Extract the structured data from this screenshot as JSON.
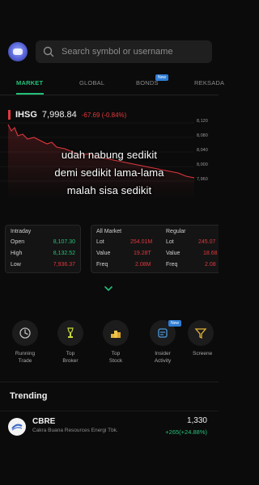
{
  "header": {
    "search_placeholder": "Search symbol or username"
  },
  "tabs": [
    {
      "label": "MARKET",
      "active": true
    },
    {
      "label": "GLOBAL",
      "active": false
    },
    {
      "label": "BONDS",
      "active": false,
      "badge": "New"
    },
    {
      "label": "REKSADA",
      "active": false
    }
  ],
  "ticker": {
    "symbol": "IHSG",
    "price": "7,998.84",
    "change": "-67.69 (-0.84%)",
    "color": "#e0383e"
  },
  "chart": {
    "y_labels": [
      "8,120",
      "8,080",
      "8,040",
      "8,000",
      "7,960"
    ]
  },
  "overlay_caption": [
    "udah nabung sedikit",
    "demi sedikit lama-lama",
    "malah sisa sedikit"
  ],
  "intraday": {
    "title": "Intraday",
    "rows": [
      {
        "label": "Open",
        "value": "8,107.30",
        "color": "green"
      },
      {
        "label": "High",
        "value": "8,132.52",
        "color": "green"
      },
      {
        "label": "Low",
        "value": "7,936.37",
        "color": "red"
      }
    ]
  },
  "all_market": {
    "title": "All Market",
    "rows": [
      {
        "label": "Lot",
        "value": "254.01M",
        "color": "red"
      },
      {
        "label": "Value",
        "value": "19.28T",
        "color": "red"
      },
      {
        "label": "Freq",
        "value": "2.08M",
        "color": "red"
      }
    ]
  },
  "regular": {
    "title": "Regular",
    "rows": [
      {
        "label": "Lot",
        "value": "245.07",
        "color": "red"
      },
      {
        "label": "Value",
        "value": "18.68",
        "color": "red"
      },
      {
        "label": "Freq",
        "value": "2.08",
        "color": "red"
      }
    ]
  },
  "shortcuts": [
    {
      "label": "Running\nTrade",
      "icon": "running-trade-icon"
    },
    {
      "label": "Top\nBroker",
      "icon": "top-broker-icon"
    },
    {
      "label": "Top\nStock",
      "icon": "top-stock-icon"
    },
    {
      "label": "Insider\nActivity",
      "icon": "insider-activity-icon",
      "badge": "New"
    },
    {
      "label": "Screene",
      "icon": "screener-icon"
    }
  ],
  "trending": {
    "title": "Trending",
    "items": [
      {
        "code": "CBRE",
        "name": "Cakra Buana Resources Energi Tbk.",
        "price": "1,330",
        "change": "+265(+24.88%)"
      }
    ]
  },
  "colors": {
    "accent": "#24c07a",
    "negative": "#e0383e",
    "background": "#0b0b0b"
  }
}
